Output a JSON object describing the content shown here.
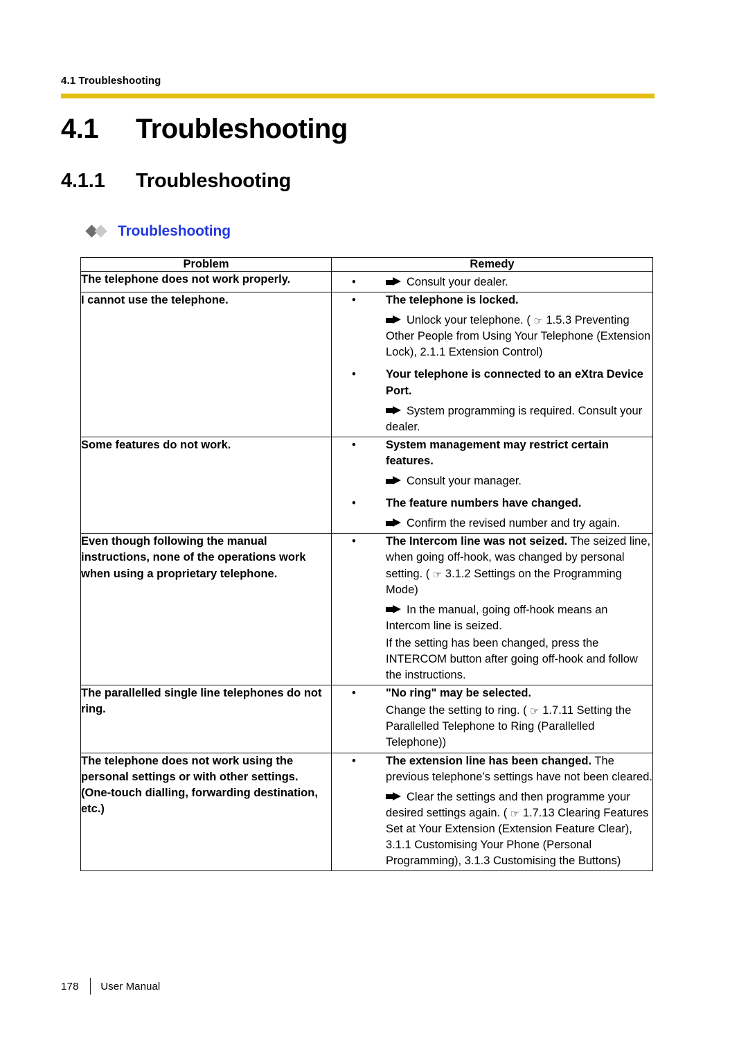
{
  "running_header": "4.1 Troubleshooting",
  "rule_color": "#E2BE10",
  "accent_color": "#2238DE",
  "heading1": {
    "number": "4.1",
    "title": "Troubleshooting"
  },
  "heading2": {
    "number": "4.1.1",
    "title": "Troubleshooting"
  },
  "heading3": {
    "title": "Troubleshooting"
  },
  "table": {
    "columns": [
      "Problem",
      "Remedy"
    ],
    "rows": [
      {
        "problem": "The telephone does not work properly.",
        "remedy": [
          {
            "bullet": "•",
            "head": "",
            "tail": "",
            "paragraphs": [
              {
                "icon": "arrow",
                "text": "Consult your dealer."
              }
            ]
          }
        ]
      },
      {
        "problem": "I cannot use the telephone.",
        "remedy": [
          {
            "bullet": "•",
            "head": "The telephone is locked.",
            "tail": "",
            "paragraphs": [
              {
                "icon": "arrow",
                "text": "Unlock your telephone. ( ☞ 1.5.3 Preventing Other People from Using Your Telephone (Extension Lock), 2.1.1 Extension Control)"
              }
            ]
          },
          {
            "bullet": "•",
            "head": "Your telephone is connected to an eXtra Device Port.",
            "tail": "",
            "paragraphs": [
              {
                "icon": "arrow",
                "text": "System programming is required. Consult your dealer."
              }
            ]
          }
        ]
      },
      {
        "problem": "Some features do not work.",
        "remedy": [
          {
            "bullet": "•",
            "head": "System management may restrict certain features.",
            "tail": "",
            "paragraphs": [
              {
                "icon": "arrow",
                "text": "Consult your manager."
              }
            ]
          },
          {
            "bullet": "•",
            "head": "The feature numbers have changed.",
            "tail": "",
            "paragraphs": [
              {
                "icon": "arrow",
                "text": "Confirm the revised number and try again."
              }
            ]
          }
        ]
      },
      {
        "problem": "Even though following the manual instructions, none of the operations work when using a proprietary telephone.",
        "remedy": [
          {
            "bullet": "•",
            "head": "The Intercom line was not seized.",
            "tail": " The seized line, when going off-hook, was changed by personal setting. ( ☞ 3.1.2 Settings on the Programming Mode)",
            "paragraphs": [
              {
                "icon": "arrow",
                "text": "In the manual, going off-hook means an Intercom line is seized."
              },
              {
                "icon": "none",
                "text": "If the setting has been changed, press the INTERCOM button after going off-hook and follow the instructions."
              }
            ]
          }
        ]
      },
      {
        "problem": "The parallelled single line telephones do not ring.",
        "remedy": [
          {
            "bullet": "•",
            "head": "\"No ring\" may be selected.",
            "tail": "",
            "paragraphs": [
              {
                "icon": "none",
                "text": "Change the setting to ring. ( ☞ 1.7.11 Setting the Parallelled Telephone to Ring (Parallelled Telephone))"
              }
            ]
          }
        ]
      },
      {
        "problem": "The telephone does not work using the personal settings or with other settings. (One-touch dialling, forwarding destination, etc.)",
        "remedy": [
          {
            "bullet": "•",
            "head": "The extension line has been changed.",
            "tail": " The previous telephone’s settings have not been cleared.",
            "paragraphs": [
              {
                "icon": "arrow",
                "text": "Clear the settings and then programme your desired settings again. ( ☞ 1.7.13 Clearing Features Set at Your Extension (Extension Feature Clear), 3.1.1 Customising Your Phone (Personal Programming), 3.1.3 Customising the Buttons)"
              }
            ]
          }
        ]
      }
    ]
  },
  "footer": {
    "page_number": "178",
    "label": "User Manual"
  }
}
